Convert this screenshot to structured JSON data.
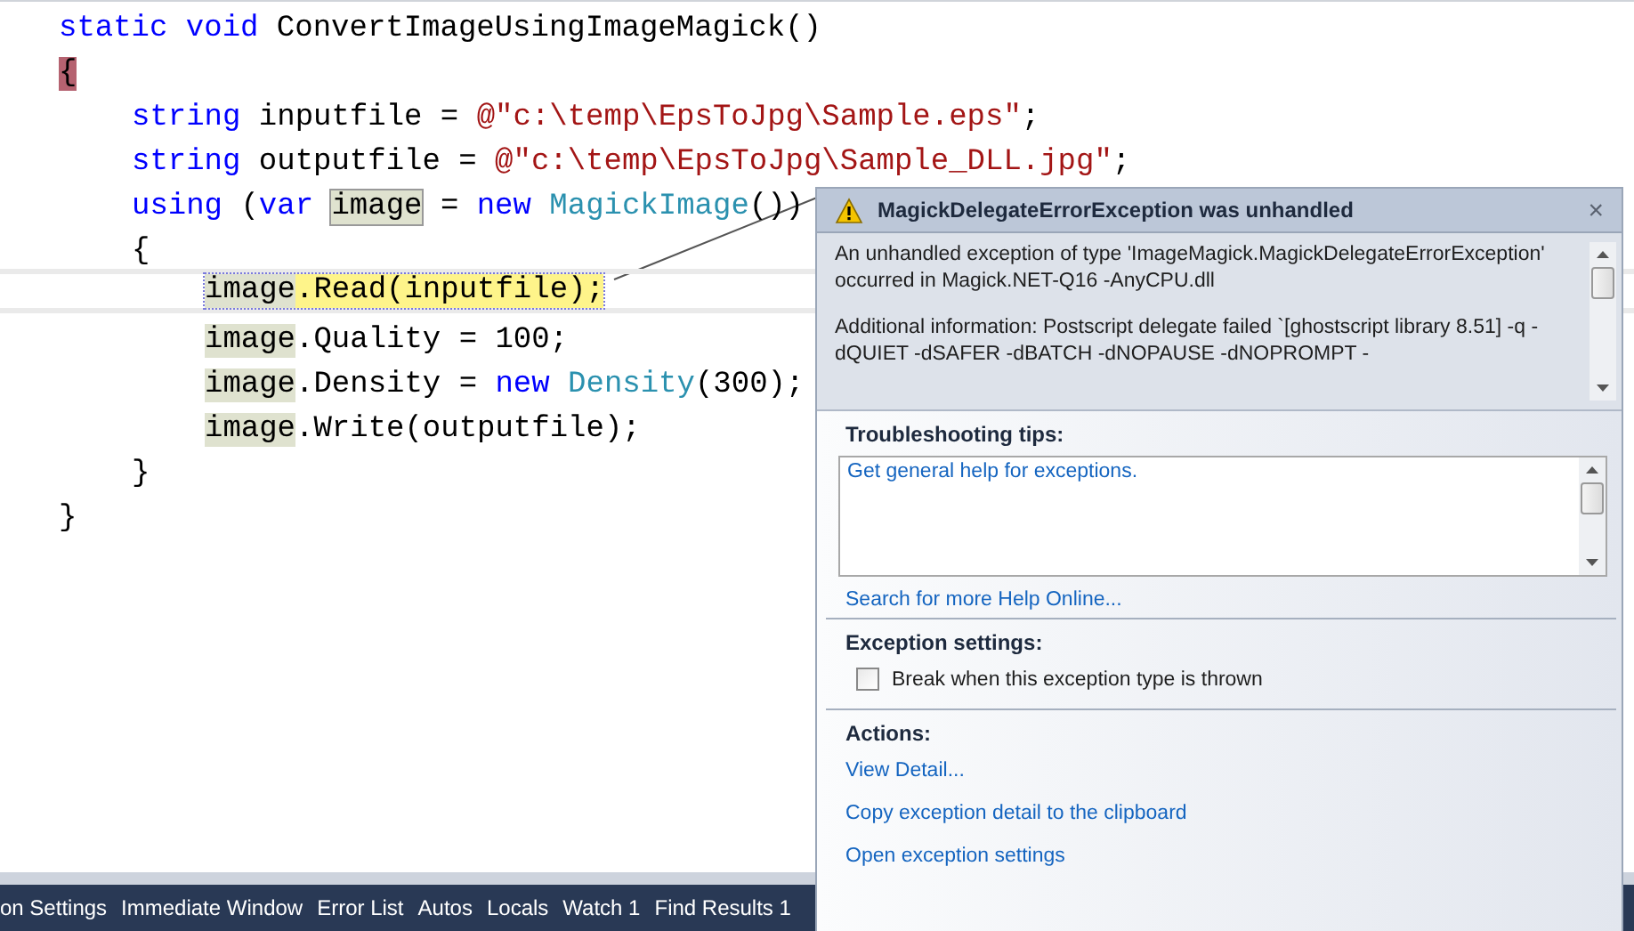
{
  "editor": {
    "lines": [
      {
        "tokens": [
          {
            "text": "static",
            "kind": "keyword"
          },
          {
            "text": " void",
            "kind": "keyword"
          },
          {
            "text": " ConvertImageUsingImageMagick()",
            "kind": "plain"
          }
        ]
      },
      {
        "tokens": [
          {
            "text": "{",
            "kind": "brace_match"
          }
        ],
        "children": [
          {
            "tokens": [
              {
                "text": "string",
                "kind": "keyword"
              },
              {
                "text": " inputfile = ",
                "kind": "plain"
              },
              {
                "text": "@\"c:\\temp\\EpsToJpg\\Sample.eps\"",
                "kind": "string"
              },
              {
                "text": ";",
                "kind": "plain"
              }
            ]
          },
          {
            "tokens": [
              {
                "text": "string",
                "kind": "keyword"
              },
              {
                "text": " outputfile = ",
                "kind": "plain"
              },
              {
                "text": "@\"c:\\temp\\EpsToJpg\\Sample_DLL.jpg\"",
                "kind": "string"
              },
              {
                "text": ";",
                "kind": "plain"
              }
            ]
          },
          {
            "tokens": [
              {
                "text": "using",
                "kind": "keyword"
              },
              {
                "text": " (",
                "kind": "plain"
              },
              {
                "text": "var ",
                "kind": "keyword"
              },
              {
                "text": "image",
                "kind": "definition"
              },
              {
                "text": " = ",
                "kind": "plain"
              },
              {
                "text": "new ",
                "kind": "keyword"
              },
              {
                "text": "MagickImage",
                "kind": "type"
              },
              {
                "text": "())",
                "kind": "plain"
              }
            ]
          },
          {
            "tokens": [
              {
                "text": "{",
                "kind": "plain"
              }
            ],
            "children": [
              {
                "current": true,
                "tokens": [
                  {
                    "text": "image",
                    "kind": "reference"
                  },
                  {
                    "text": ".Read(inputfile);",
                    "kind": "plain"
                  }
                ]
              },
              {
                "tokens": [
                  {
                    "text": "image",
                    "kind": "reference"
                  },
                  {
                    "text": ".Quality = 100;",
                    "kind": "plain"
                  }
                ]
              },
              {
                "tokens": [
                  {
                    "text": "image",
                    "kind": "reference"
                  },
                  {
                    "text": ".Density = ",
                    "kind": "plain"
                  },
                  {
                    "text": "new ",
                    "kind": "keyword"
                  },
                  {
                    "text": "Density",
                    "kind": "type"
                  },
                  {
                    "text": "(300);",
                    "kind": "plain"
                  }
                ]
              },
              {
                "tokens": [
                  {
                    "text": "image",
                    "kind": "reference"
                  },
                  {
                    "text": ".Write(outputfile);",
                    "kind": "plain"
                  }
                ]
              }
            ]
          },
          {
            "tokens": [
              {
                "text": "}",
                "kind": "plain"
              }
            ]
          }
        ]
      },
      {
        "tokens": [
          {
            "text": "}",
            "kind": "plain"
          }
        ]
      }
    ]
  },
  "tool_tabs": [
    "on Settings",
    "Immediate Window",
    "Error List",
    "Autos",
    "Locals",
    "Watch 1",
    "Find Results 1"
  ],
  "exception_popup": {
    "title": "MagickDelegateErrorException was unhandled",
    "close": "×",
    "message": [
      "An unhandled exception of type 'ImageMagick.MagickDelegateErrorException' occurred in Magick.NET-Q16 -AnyCPU.dll",
      "Additional information: Postscript delegate failed `[ghostscript library 8.51] -q -dQUIET -dSAFER -dBATCH -dNOPAUSE -dNOPROMPT -"
    ],
    "troubleshooting": {
      "heading": "Troubleshooting tips:",
      "tips": [
        "Get general help for exceptions."
      ],
      "search_link": "Search for more Help Online..."
    },
    "settings": {
      "heading": "Exception settings:",
      "checkbox": {
        "label": "Break when this exception type is thrown",
        "checked": false
      }
    },
    "actions": {
      "heading": "Actions:",
      "links": [
        "View Detail...",
        "Copy exception detail to the clipboard",
        "Open exception settings"
      ]
    }
  }
}
